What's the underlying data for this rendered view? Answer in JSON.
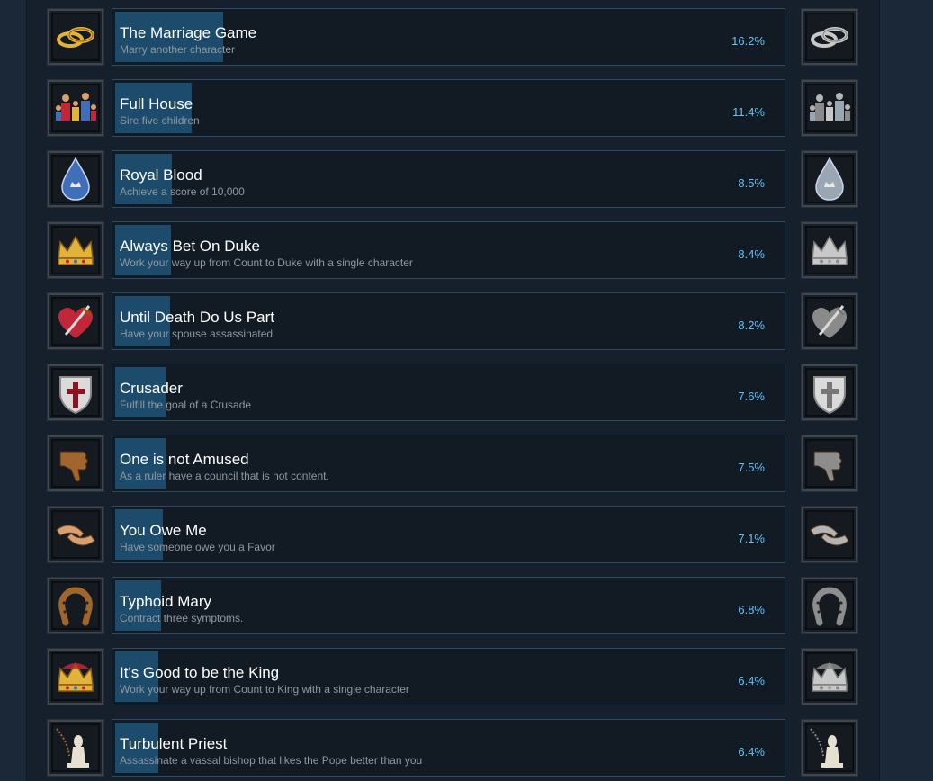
{
  "colors": {
    "page_bg": "#1b2838",
    "panel_bg": "#16202d",
    "row_bg": "#121a24",
    "row_border": "#2c4a63",
    "progress_fill": "#1c4b6c",
    "title_text": "#ffffff",
    "desc_text": "#8f98a0",
    "percent_text": "#67c1f5"
  },
  "achievements": [
    {
      "title": "The Marriage Game",
      "desc": "Marry another character",
      "pct": "16.2%",
      "unlock_rate": 0.162,
      "icon": "rings-icon"
    },
    {
      "title": "Full House",
      "desc": "Sire five children",
      "pct": "11.4%",
      "unlock_rate": 0.114,
      "icon": "family-icon"
    },
    {
      "title": "Royal Blood",
      "desc": "Achieve a score of 10,000",
      "pct": "8.5%",
      "unlock_rate": 0.085,
      "icon": "blood-drop-icon"
    },
    {
      "title": "Always Bet On Duke",
      "desc": "Work your way up from Count to Duke with a single character",
      "pct": "8.4%",
      "unlock_rate": 0.084,
      "icon": "ducal-crown-icon"
    },
    {
      "title": "Until Death Do Us Part",
      "desc": "Have your spouse assassinated",
      "pct": "8.2%",
      "unlock_rate": 0.082,
      "icon": "stabbed-heart-icon"
    },
    {
      "title": "Crusader",
      "desc": "Fulfill the goal of a Crusade",
      "pct": "7.6%",
      "unlock_rate": 0.076,
      "icon": "crusader-shield-icon"
    },
    {
      "title": "One is not Amused",
      "desc": "As a ruler have a council that is not content.",
      "pct": "7.5%",
      "unlock_rate": 0.075,
      "icon": "thumbs-down-icon"
    },
    {
      "title": "You Owe Me",
      "desc": "Have someone owe you a Favor",
      "pct": "7.1%",
      "unlock_rate": 0.071,
      "icon": "hands-icon"
    },
    {
      "title": "Typhoid Mary",
      "desc": "Contract three symptoms.",
      "pct": "6.8%",
      "unlock_rate": 0.068,
      "icon": "horseshoe-icon"
    },
    {
      "title": "It's Good to be the King",
      "desc": "Work your way up from Count to King with a single character",
      "pct": "6.4%",
      "unlock_rate": 0.064,
      "icon": "royal-crown-icon"
    },
    {
      "title": "Turbulent Priest",
      "desc": "Assassinate a vassal bishop that likes the Pope better than you",
      "pct": "6.4%",
      "unlock_rate": 0.064,
      "icon": "bishop-rosary-icon"
    }
  ]
}
